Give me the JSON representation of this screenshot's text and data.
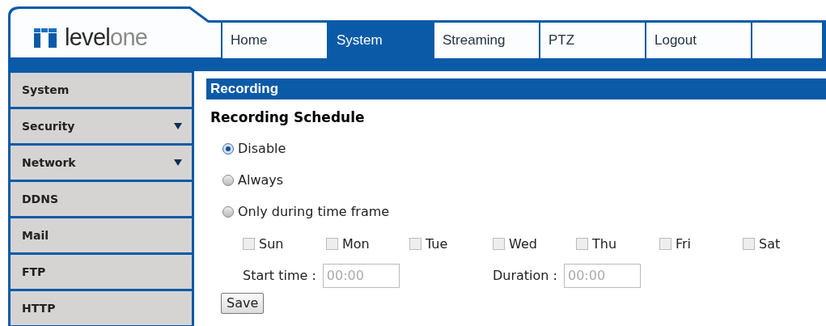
{
  "logo": {
    "dark_part": "level",
    "light_part": "one"
  },
  "tabs": [
    {
      "label": "Home",
      "selected": false
    },
    {
      "label": "System",
      "selected": true
    },
    {
      "label": "Streaming",
      "selected": false
    },
    {
      "label": "PTZ",
      "selected": false
    },
    {
      "label": "Logout",
      "selected": false
    }
  ],
  "sidebar": {
    "items": [
      {
        "label": "System",
        "expandable": false
      },
      {
        "label": "Security",
        "expandable": true
      },
      {
        "label": "Network",
        "expandable": true
      },
      {
        "label": "DDNS",
        "expandable": false
      },
      {
        "label": "Mail",
        "expandable": false
      },
      {
        "label": "FTP",
        "expandable": false
      },
      {
        "label": "HTTP",
        "expandable": false
      }
    ]
  },
  "panel": {
    "title": "Recording",
    "heading": "Recording Schedule",
    "options": [
      {
        "label": "Disable",
        "selected": true
      },
      {
        "label": "Always",
        "selected": false
      },
      {
        "label": "Only during time frame",
        "selected": false
      }
    ],
    "days": [
      {
        "label": "Sun",
        "checked": false,
        "disabled": true
      },
      {
        "label": "Mon",
        "checked": false,
        "disabled": true
      },
      {
        "label": "Tue",
        "checked": false,
        "disabled": true
      },
      {
        "label": "Wed",
        "checked": false,
        "disabled": true
      },
      {
        "label": "Thu",
        "checked": false,
        "disabled": true
      },
      {
        "label": "Fri",
        "checked": false,
        "disabled": true
      },
      {
        "label": "Sat",
        "checked": false,
        "disabled": true
      }
    ],
    "fields": [
      {
        "label": "Start time :",
        "value": "00:00",
        "disabled": true
      },
      {
        "label": "Duration :",
        "value": "00:00",
        "disabled": true
      }
    ],
    "save_button": "Save"
  }
}
